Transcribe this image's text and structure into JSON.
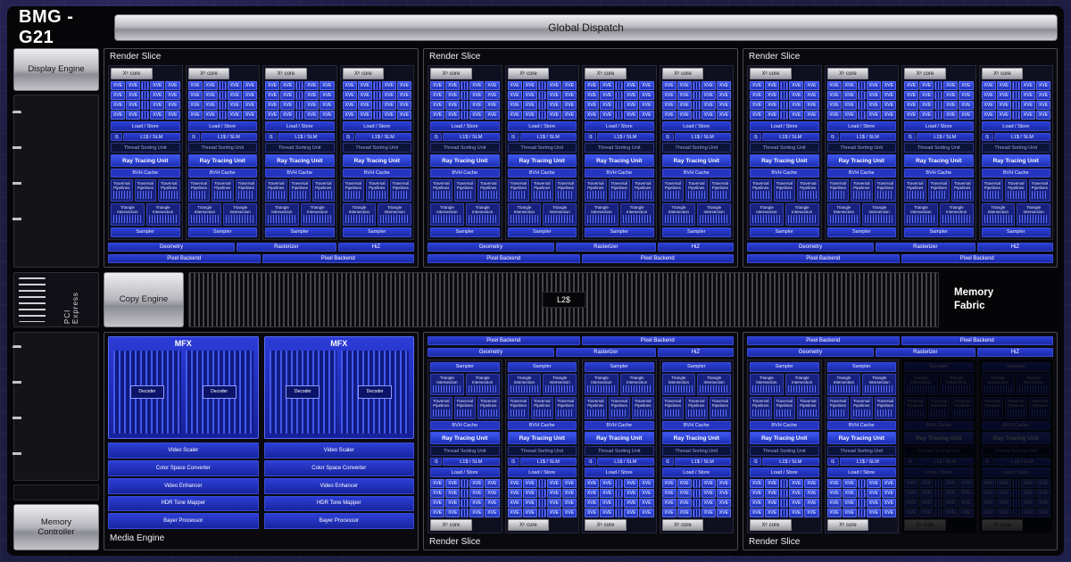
{
  "header": {
    "title": "BMG - G21",
    "global_dispatch": "Global Dispatch"
  },
  "sidebar": {
    "display_engine": "Display Engine",
    "pci_express": "PCI Express",
    "memory_controller": "Memory Controller"
  },
  "interconnect": {
    "copy_engine": "Copy Engine",
    "l2_cache": "L2$",
    "memory_fabric": "Memory Fabric"
  },
  "render_slice": {
    "title": "Render Slice",
    "core": {
      "tab": "Xᵉ core",
      "xve": "XVE",
      "load_store": "Load / Store",
      "icache": "I$",
      "l1_slm": "L1$ / SLM",
      "thread_sorting": "Thread Sorting Unit",
      "ray_tracing": "Ray Tracing Unit",
      "bvh_cache": "BVH Cache",
      "traversal": "Traversal Pipelines",
      "triangle": "Triangle Intersection",
      "sampler": "Sampler"
    },
    "shared": {
      "geometry": "Geometry",
      "rasterizer": "Rasterizer",
      "hiz": "HiZ",
      "pixel_backend": "Pixel Backend"
    }
  },
  "media_engine": {
    "title": "Media Engine",
    "mfx": "MFX",
    "decoder": "Decoder",
    "pipeline": [
      "Video Scaler",
      "Color Space Converter",
      "Video Enhancer",
      "HDR Tone Mapper",
      "Bayer Processor"
    ]
  },
  "layout": {
    "top_slices": 3,
    "bottom_slices": 2,
    "cores_per_slice": 4,
    "xve_rows": 4,
    "xve_per_row": 4,
    "traversal_boxes": 3,
    "triangle_boxes": 2,
    "mfx_units": 2,
    "decoders_per_mfx": 2,
    "media_columns": 2,
    "disabled_cores_in_last_slice": 2
  },
  "colors": {
    "accent_blue": "#2b3cd8",
    "background": "#1d1d42",
    "metal_gray": "#b5b5bc"
  }
}
